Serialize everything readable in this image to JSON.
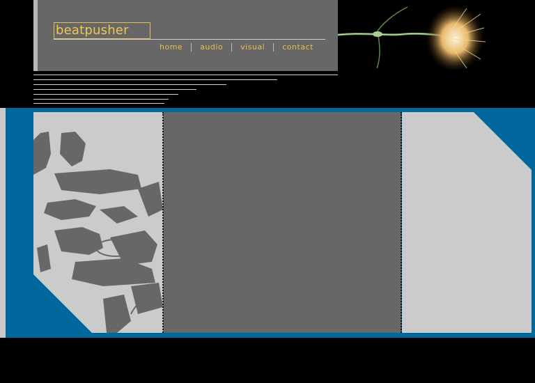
{
  "header": {
    "logo_text": "beatpusher",
    "nav": {
      "home": "home",
      "audio": "audio",
      "visual": "visual",
      "contact": "contact"
    }
  },
  "colors": {
    "accent": "#e8bf49",
    "band_blue": "#00679d",
    "panel_gray": "#676767",
    "light_gray": "#cbcbcb",
    "background": "#000000"
  },
  "icons": {
    "flower": "dandelion-flower-image",
    "photo": "dj-turntable-photo"
  }
}
